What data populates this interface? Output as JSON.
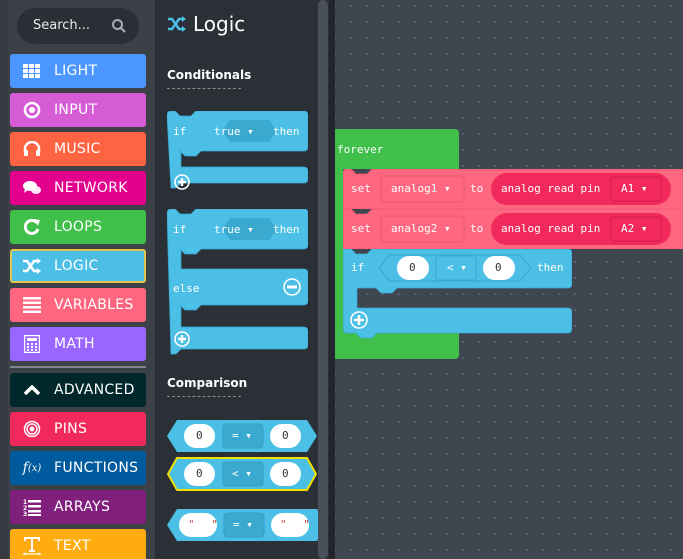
{
  "sidebar": {
    "search_placeholder": "Search...",
    "categories": [
      {
        "label": "LIGHT",
        "icon": "grid-icon",
        "color": "#4c97ff"
      },
      {
        "label": "INPUT",
        "icon": "target-icon",
        "color": "#d65cd6"
      },
      {
        "label": "MUSIC",
        "icon": "headphones-icon",
        "color": "#fe6442"
      },
      {
        "label": "NETWORK",
        "icon": "chat-icon",
        "color": "#e3008c"
      },
      {
        "label": "LOOPS",
        "icon": "refresh-icon",
        "color": "#40bf4a"
      },
      {
        "label": "LOGIC",
        "icon": "shuffle-icon",
        "color": "#4cbfe6",
        "selected": true
      },
      {
        "label": "VARIABLES",
        "icon": "list-icon",
        "color": "#ff6680"
      },
      {
        "label": "MATH",
        "icon": "calculator-icon",
        "color": "#9966ff"
      },
      {
        "label": "ADVANCED",
        "icon": "chevron-up-icon",
        "color": "#00272b"
      },
      {
        "label": "PINS",
        "icon": "pins-icon",
        "color": "#f2295b"
      },
      {
        "label": "FUNCTIONS",
        "icon": "function-icon",
        "color": "#005a9e"
      },
      {
        "label": "ARRAYS",
        "icon": "numbered-list-icon",
        "color": "#801f7c"
      },
      {
        "label": "TEXT",
        "icon": "text-icon",
        "color": "#ffac10"
      }
    ]
  },
  "flyout": {
    "title": "Logic",
    "sections": {
      "conditionals": "Conditionals",
      "comparison": "Comparison"
    },
    "blocks": {
      "if_then": {
        "if": "if",
        "cond": "true ▾",
        "then": "then"
      },
      "if_else": {
        "if": "if",
        "cond": "true ▾",
        "then": "then",
        "else": "else"
      },
      "compare_eq": {
        "left": "0",
        "op": "= ▾",
        "right": "0"
      },
      "compare_lt": {
        "left": "0",
        "op": "< ▾",
        "right": "0"
      },
      "compare_str": {
        "left": "\" \"",
        "op": "= ▾",
        "right": "\" \""
      }
    }
  },
  "workspace": {
    "forever": "forever",
    "set1": {
      "set": "set",
      "var": "analog1 ▾",
      "to": "to",
      "read": "analog read pin",
      "pin": "A1 ▾"
    },
    "set2": {
      "set": "set",
      "var": "analog2 ▾",
      "to": "to",
      "read": "analog read pin",
      "pin": "A2 ▾"
    },
    "if_block": {
      "if": "if",
      "left": "0",
      "op": "< ▾",
      "right": "0",
      "then": "then"
    }
  },
  "colors": {
    "logic": "#4cbfe6",
    "loops": "#40bf4a",
    "variables": "#ff6680",
    "pins": "#f2295b"
  }
}
